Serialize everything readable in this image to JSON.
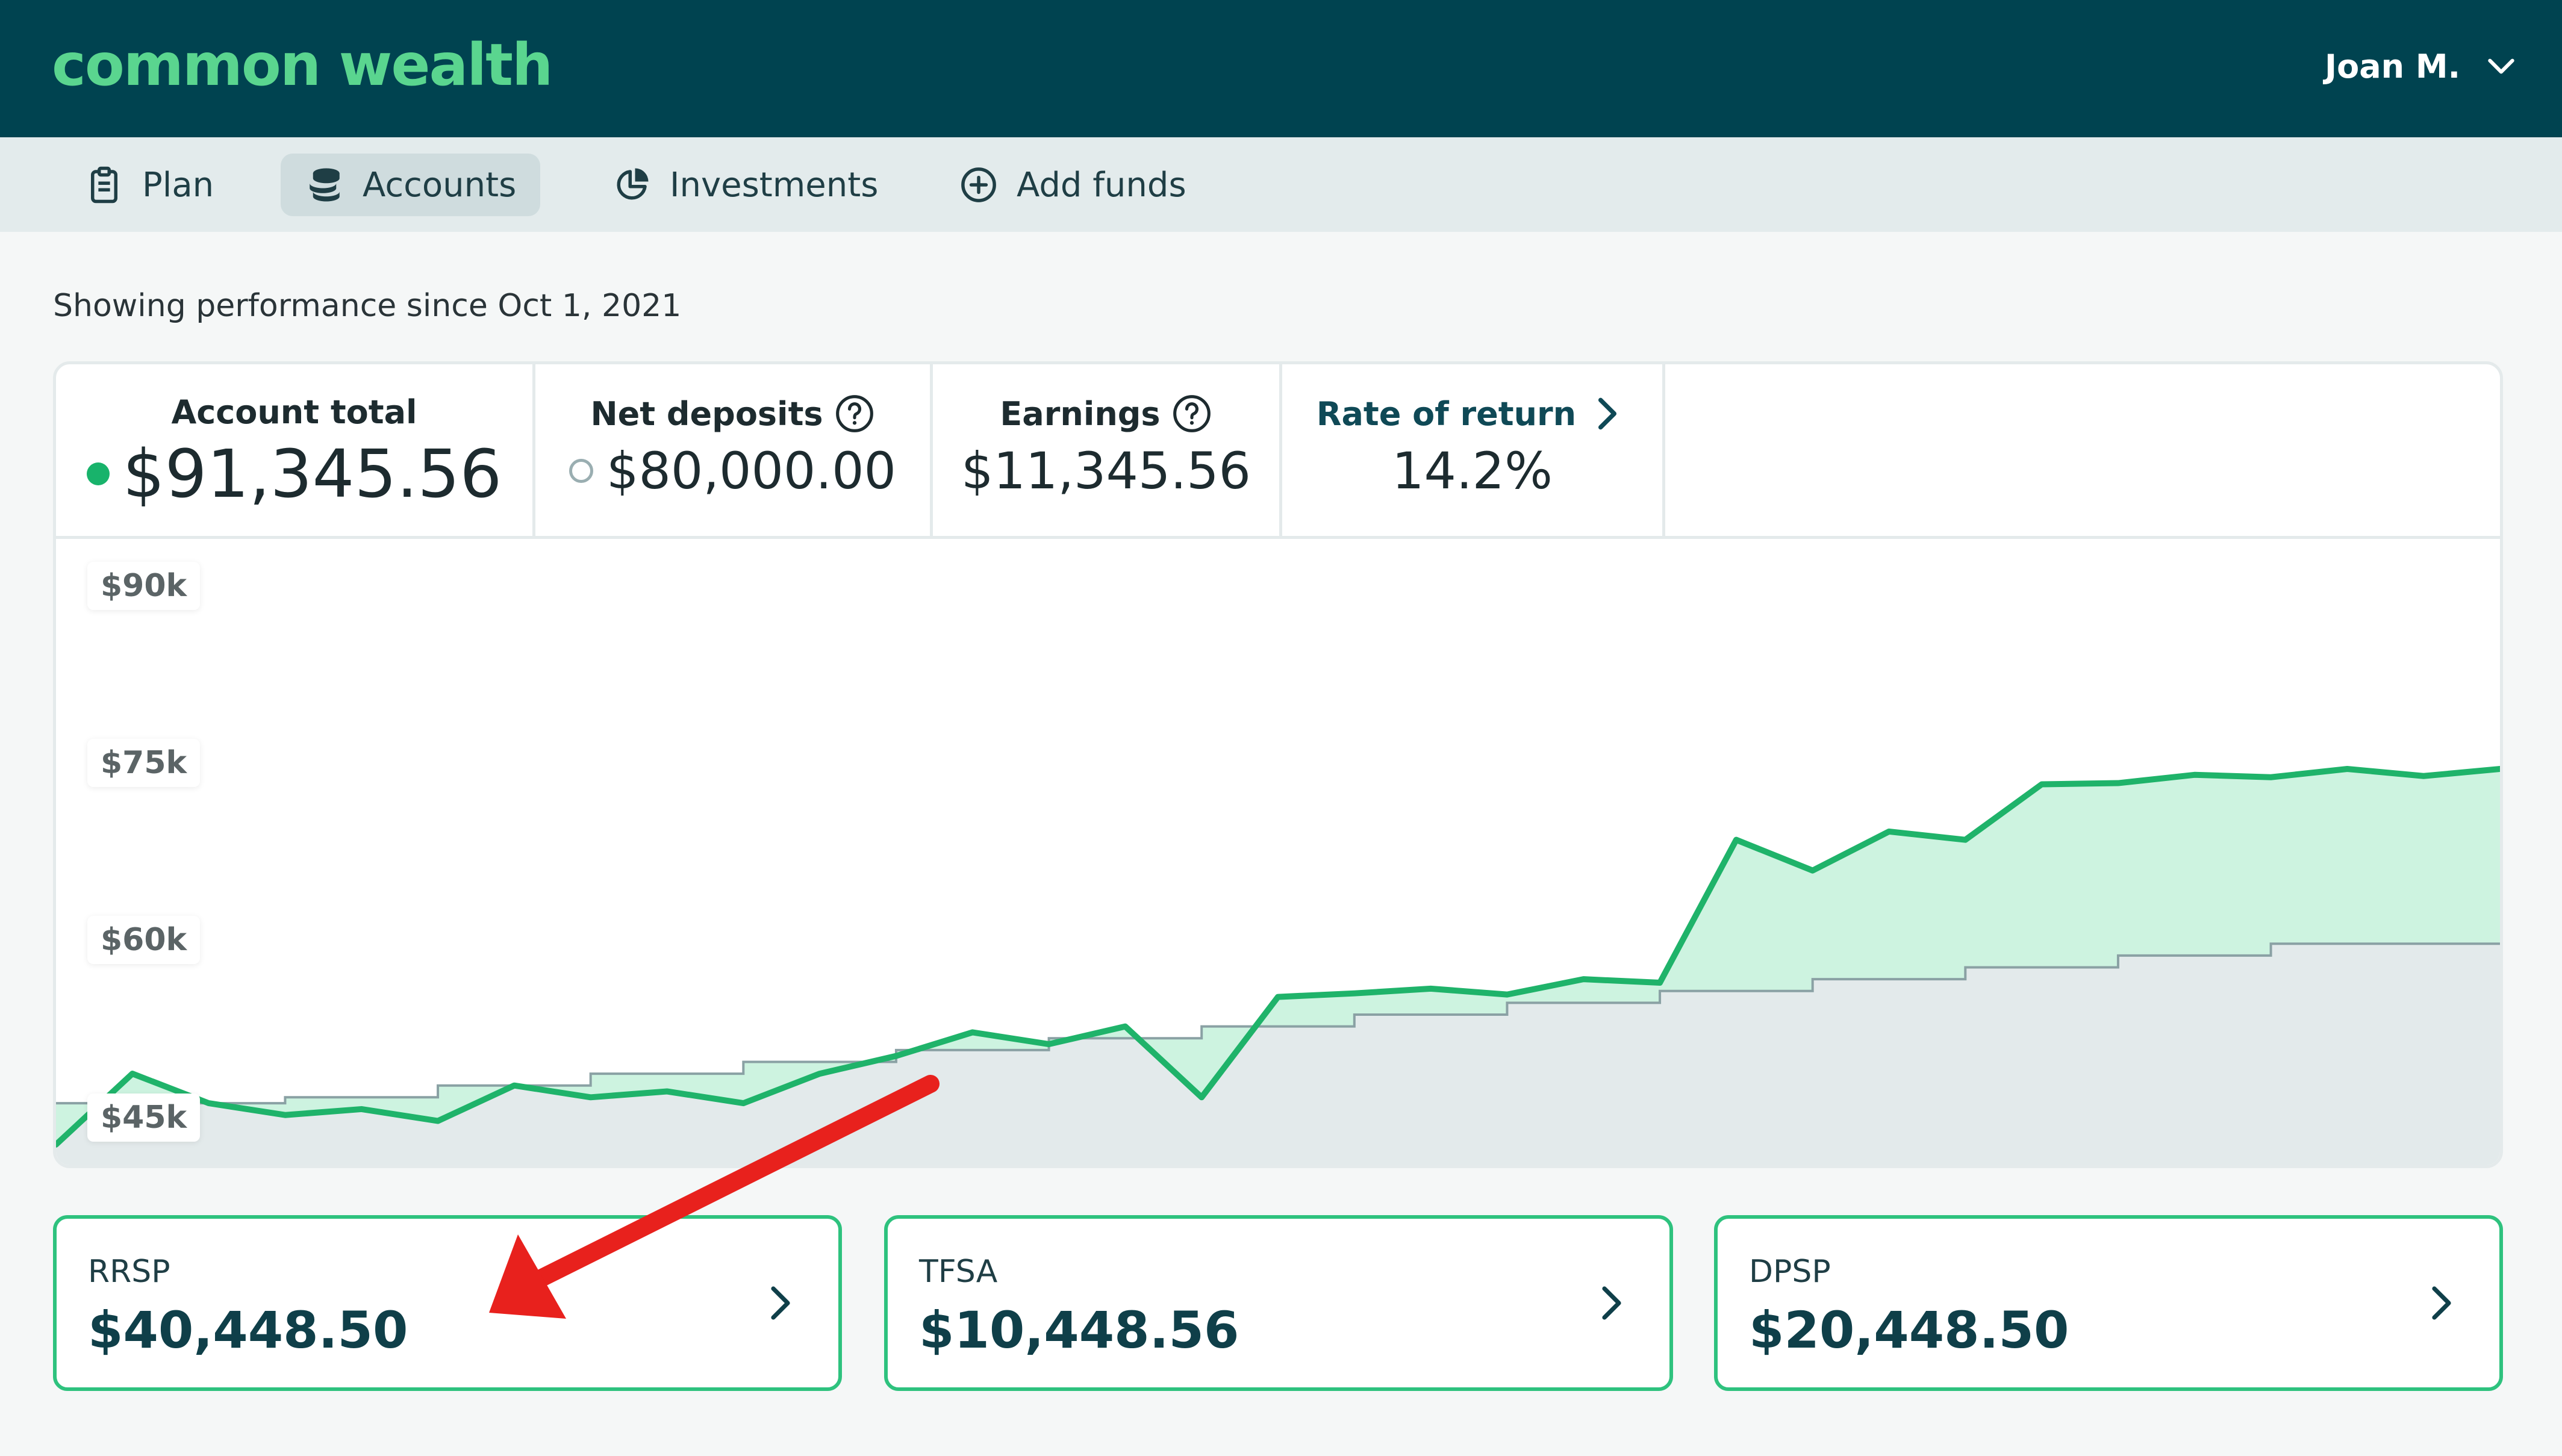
{
  "header": {
    "logo_text": "common wealth",
    "user_name": "Joan M.",
    "user_menu_icon": "chevron-down-icon"
  },
  "nav": {
    "items": [
      {
        "label": "Plan",
        "icon": "clipboard-icon",
        "active": false
      },
      {
        "label": "Accounts",
        "icon": "coins-stack-icon",
        "active": true
      },
      {
        "label": "Investments",
        "icon": "pie-chart-icon",
        "active": false
      },
      {
        "label": "Add funds",
        "icon": "plus-circle-icon",
        "active": false
      }
    ]
  },
  "performance": {
    "since_text": "Showing performance since Oct 1, 2021"
  },
  "stats": {
    "account_total": {
      "label": "Account total",
      "value": "$91,345.56"
    },
    "net_deposits": {
      "label": "Net deposits",
      "value": "$80,000.00"
    },
    "earnings": {
      "label": "Earnings",
      "value": "$11,345.56"
    },
    "rate_of_return": {
      "label": "Rate of return",
      "value": "14.2%"
    }
  },
  "chart_data": {
    "type": "area",
    "y_tick_labels": [
      "$90k",
      "$75k",
      "$60k",
      "$45k"
    ],
    "ylim": [
      41000,
      93000
    ],
    "y_ticks": [
      90000,
      75000,
      60000,
      45000
    ],
    "x": [
      0,
      1,
      2,
      3,
      4,
      5,
      6,
      7,
      8,
      9,
      10,
      11,
      12,
      13,
      14,
      15,
      16,
      17,
      18,
      19,
      20,
      21,
      22,
      23,
      24,
      25,
      26,
      27,
      28,
      29,
      30,
      31,
      32
    ],
    "series": [
      {
        "values": [
          43000,
          49000,
          46500,
          45500,
          46000,
          45000,
          48000,
          47000,
          47500,
          46500,
          49000,
          50500,
          52500,
          51500,
          53000,
          47000,
          55500,
          55800,
          56200,
          55700,
          57000,
          56700,
          68800,
          66200,
          69500,
          68800,
          73500,
          73600,
          74300,
          74100,
          74800,
          74200,
          74800
        ]
      },
      {
        "values": [
          46500,
          46500,
          46500,
          47000,
          47000,
          48000,
          48000,
          49000,
          49000,
          50000,
          50000,
          51000,
          51000,
          52000,
          52000,
          53000,
          53000,
          54000,
          54000,
          55000,
          55000,
          56000,
          56000,
          57000,
          57000,
          58000,
          58000,
          59000,
          59000,
          60000,
          60000,
          60000,
          60000
        ]
      }
    ],
    "colors": {
      "total_line": "#1fb36a",
      "earnings_fill": "#cdf3e0",
      "deposits_line": "#8aa1a4",
      "deposits_fill": "#e3eaeb"
    },
    "grid": false,
    "legend": "none"
  },
  "accounts": [
    {
      "name": "RRSP",
      "balance": "$40,448.50"
    },
    {
      "name": "TFSA",
      "balance": "$10,448.56"
    },
    {
      "name": "DPSP",
      "balance": "$20,448.50"
    }
  ],
  "annotation": {
    "color": "#e8211d"
  }
}
